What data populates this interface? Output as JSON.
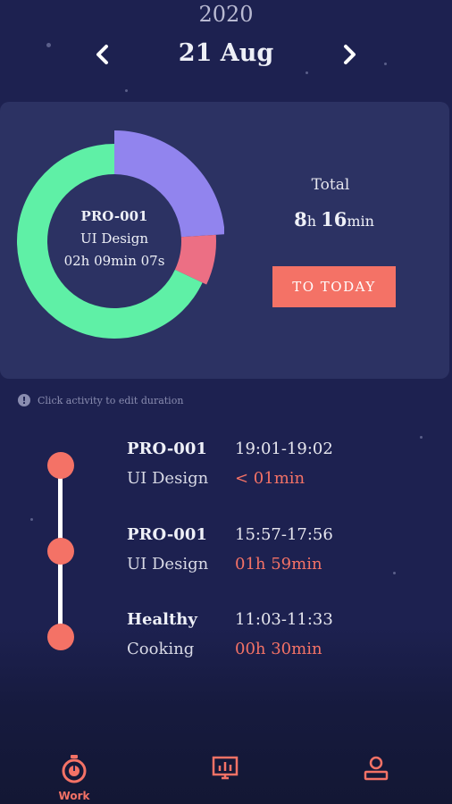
{
  "header": {
    "year": "2020",
    "date": "21 Aug"
  },
  "summary": {
    "center_project": "PRO-001",
    "center_task": "UI Design",
    "center_duration": "02h 09min 07s",
    "total_label": "Total",
    "total_hours": "8",
    "total_hours_unit": "h",
    "total_minutes": "16",
    "total_minutes_unit": "min",
    "to_today_label": "TO TODAY"
  },
  "chart_data": {
    "type": "pie",
    "segments": [
      {
        "name": "",
        "fraction": 0.24,
        "color": "#9184ee"
      },
      {
        "name": "",
        "fraction": 0.08,
        "color": "#ec6f84"
      },
      {
        "name": "",
        "fraction": 0.68,
        "color": "#5ff0a6"
      }
    ]
  },
  "hint": {
    "text": "Click activity to edit duration"
  },
  "activities": [
    {
      "project": "PRO-001",
      "time_range": "19:01-19:02",
      "task": "UI Design",
      "duration": "< 01min"
    },
    {
      "project": "PRO-001",
      "time_range": "15:57-17:56",
      "task": "UI Design",
      "duration": "01h 59min"
    },
    {
      "project": "Healthy",
      "time_range": "11:03-11:33",
      "task": "Cooking",
      "duration": "00h 30min"
    }
  ],
  "tabs": [
    {
      "label": "Work",
      "icon": "stopwatch-icon",
      "active": true
    },
    {
      "label": "",
      "icon": "chart-board-icon",
      "active": false
    },
    {
      "label": "",
      "icon": "profile-icon",
      "active": false
    }
  ],
  "colors": {
    "accent": "#f47266",
    "background": "#1d2150",
    "card": "#2c3263"
  }
}
